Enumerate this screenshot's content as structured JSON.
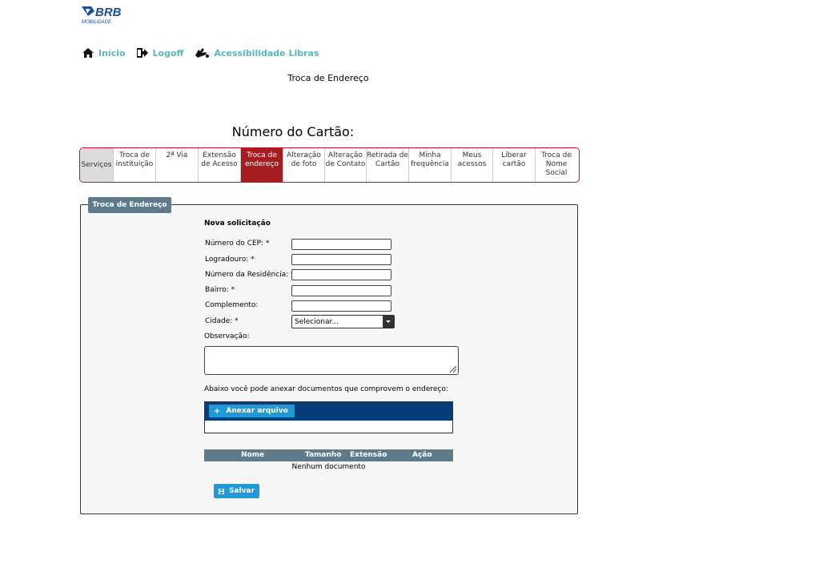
{
  "logo": {
    "brand": "BRB",
    "subtitle": "MOBILIDADE"
  },
  "nav": {
    "home_label": "Início",
    "logoff_label": "Logoff",
    "accessibility_label": "Acessibilidade Libras"
  },
  "page": {
    "header": "Troca de Endereço",
    "card_number_label": "Número do Cartão:"
  },
  "tabs": [
    {
      "label": "Serviços"
    },
    {
      "label": "Troca de instituição"
    },
    {
      "label": "2ª Via"
    },
    {
      "label": "Extensão de Acesso"
    },
    {
      "label": "Troca de endereço",
      "active": true
    },
    {
      "label": "Alteração de foto"
    },
    {
      "label": "Alteração de Contato"
    },
    {
      "label": "Retirada de Cartão"
    },
    {
      "label": "Minha frequência"
    },
    {
      "label": "Meus acessos"
    },
    {
      "label": "Liberar cartão"
    },
    {
      "label": "Troca de Nome Social"
    }
  ],
  "form": {
    "legend": "Troca de Endereço",
    "title": "Nova solicitação",
    "cep_label": "Número do CEP: *",
    "cep_value": "",
    "street_label": "Logradouro: *",
    "street_value": "",
    "number_label": "Número da Residência: *",
    "number_value": "",
    "district_label": "Bairro: *",
    "district_value": "",
    "complement_label": "Complemento:",
    "complement_value": "",
    "city_label": "Cidade: *",
    "city_selected": "Selecionar...",
    "observation_label": "Observação:",
    "observation_value": "",
    "attach_note": "Abaixo você pode anexar documentos que comprovem o endereço:",
    "attach_button": "Anexar arquivo",
    "table_headers": [
      "Nome",
      "Tamanho",
      "Extensão",
      "Ação"
    ],
    "table_empty": "Nenhum documento",
    "save_button": "Salvar"
  },
  "colors": {
    "brand_blue": "#1a4f9c",
    "link_teal": "#56b7c0",
    "active_tab": "#a41d21",
    "tab_border": "#c8102e",
    "legend_bg": "#5d7b8a",
    "upload_bar": "#073e79",
    "button_blue": "#1e9ad6"
  }
}
